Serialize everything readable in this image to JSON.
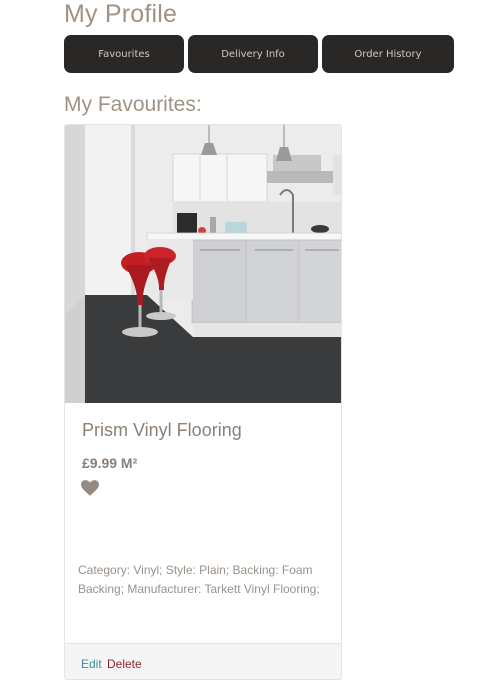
{
  "header": {
    "title": "My Profile"
  },
  "tabs": [
    {
      "label": "Favourites"
    },
    {
      "label": "Delivery Info"
    },
    {
      "label": "Order History"
    }
  ],
  "favourites": {
    "title": "My Favourites:",
    "items": [
      {
        "name": "Prism Vinyl Flooring",
        "price": "£9.99 M²",
        "description": "Category: Vinyl; Style: Plain; Backing: Foam Backing; Manufacturer: Tarkett Vinyl Flooring;",
        "edit_label": "Edit",
        "delete_label": "Delete",
        "icon": "heart-icon"
      }
    ]
  },
  "colors": {
    "accent": "#a09284",
    "tab_bg": "#2a2727",
    "edit": "#3b8f9c",
    "delete": "#8f2330"
  }
}
